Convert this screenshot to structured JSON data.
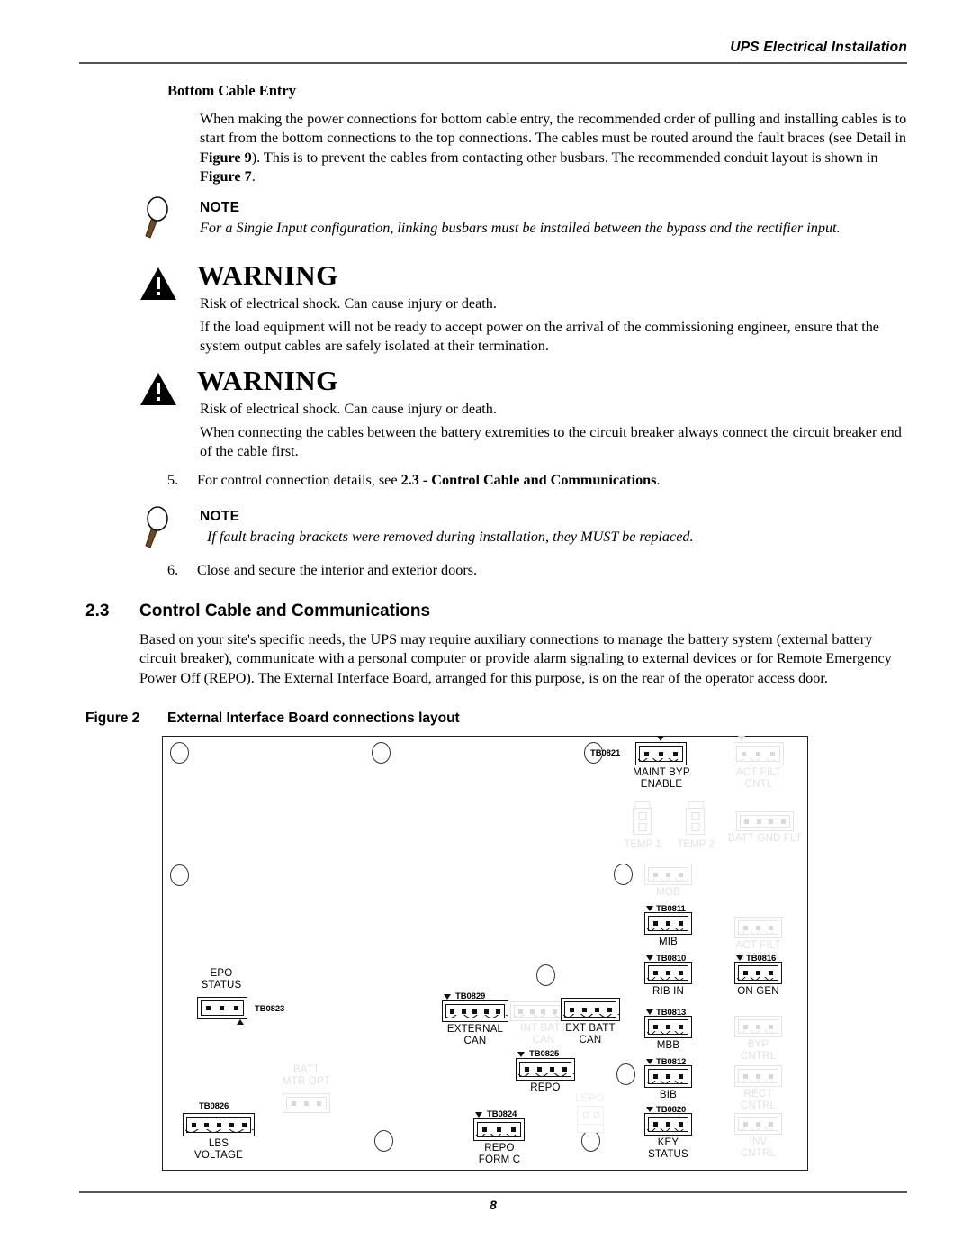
{
  "header": {
    "title": "UPS Electrical Installation"
  },
  "footer": {
    "page_number": "8"
  },
  "body": {
    "bottom_cable_entry_heading": "Bottom Cable Entry",
    "bottom_cable_entry_p1_a": "When making the power connections for bottom cable entry, the recommended order of pulling and installing cables is to start from the bottom connections to the top connections. The cables must be routed around the fault braces (see Detail in ",
    "bottom_cable_entry_p1_fig9": "Figure 9",
    "bottom_cable_entry_p1_b": "). This is to prevent the cables from contacting other busbars. The recommended conduit layout is shown in ",
    "bottom_cable_entry_p1_fig7": "Figure 7",
    "bottom_cable_entry_p1_c": ".",
    "note1_word": "NOTE",
    "note1_text": "For a Single Input configuration, linking busbars must be installed between the bypass and the rectifier input.",
    "warning1_word": "WARNING",
    "warning1_line1": "Risk of electrical shock. Can cause injury or death.",
    "warning1_line2": "If the load equipment will not be ready to accept power on the arrival of the commissioning engineer, ensure that the system output cables are safely isolated at their termination.",
    "warning2_word": "WARNING",
    "warning2_line1": "Risk of electrical shock. Can cause injury or death.",
    "warning2_line2": "When connecting the cables between the battery extremities to the circuit breaker always connect the circuit breaker end of the cable first.",
    "item5_num": "5.",
    "item5_a": "For control connection details, see ",
    "item5_b": "2.3 - Control Cable and Communications",
    "item5_c": ".",
    "note2_word": "NOTE",
    "note2_text": "If fault bracing brackets were removed during installation, they MUST be replaced.",
    "item6_num": "6.",
    "item6_text": "Close and secure the interior and exterior doors.",
    "section_number": "2.3",
    "section_title": "Control Cable and Communications",
    "section_para": "Based on your site's specific needs, the UPS may require auxiliary connections to manage the battery system (external battery circuit breaker), communicate with a personal computer or provide alarm signaling to external devices or for Remote Emergency Power Off (REPO). The External Interface Board, arranged for this purpose, is on the rear of the operator access door.",
    "figure_label": "Figure 2",
    "figure_title": "External Interface Board connections layout"
  },
  "figure": {
    "connectors": [
      {
        "id": "tb0821",
        "tb": "TB0821",
        "label": "MAINT BYP\nENABLE",
        "pins": 3,
        "ghost": false
      },
      {
        "id": "act_filt_cntl",
        "tb": "",
        "label": "ACT FILT\nCNTL",
        "pins": 3,
        "ghost": true
      },
      {
        "id": "temp1",
        "tb": "",
        "label": "TEMP 1",
        "pins": 2,
        "ghost": true
      },
      {
        "id": "temp2",
        "tb": "",
        "label": "TEMP 2",
        "pins": 2,
        "ghost": true
      },
      {
        "id": "batt_gnd_flt",
        "tb": "",
        "label": "BATT GND FLT",
        "pins": 4,
        "ghost": true
      },
      {
        "id": "mob",
        "tb": "",
        "label": "MOB",
        "pins": 3,
        "ghost": true
      },
      {
        "id": "tb0811",
        "tb": "TB0811",
        "label": "MIB",
        "pins": 3,
        "ghost": false
      },
      {
        "id": "act_filt_status",
        "tb": "",
        "label": "ACT FILT\nSTATUS",
        "pins": 3,
        "ghost": true
      },
      {
        "id": "tb0810",
        "tb": "TB0810",
        "label": "RIB IN",
        "pins": 3,
        "ghost": false
      },
      {
        "id": "tb0816",
        "tb": "TB0816",
        "label": "ON GEN",
        "pins": 3,
        "ghost": false
      },
      {
        "id": "tb0823",
        "tb": "TB0823",
        "label": "EPO\nSTATUS",
        "pins": 3,
        "ghost": false
      },
      {
        "id": "tb0829",
        "tb": "TB0829",
        "label": "EXTERNAL\nCAN",
        "pins": 5,
        "ghost": false
      },
      {
        "id": "int_batt_can",
        "tb": "",
        "label": "INT BATT\nCAN",
        "pins": 5,
        "ghost": true
      },
      {
        "id": "ext_batt_can",
        "tb": "",
        "label": "EXT BATT\nCAN",
        "pins": 4,
        "ghost": false
      },
      {
        "id": "tb0813",
        "tb": "TB0813",
        "label": "MBB",
        "pins": 3,
        "ghost": false
      },
      {
        "id": "byp_cntrl",
        "tb": "",
        "label": "BYP\nCNTRL",
        "pins": 3,
        "ghost": true
      },
      {
        "id": "tb0825",
        "tb": "TB0825",
        "label": "REPO",
        "pins": 4,
        "ghost": false
      },
      {
        "id": "tb0812",
        "tb": "TB0812",
        "label": "BIB",
        "pins": 3,
        "ghost": false
      },
      {
        "id": "rect_cntrl",
        "tb": "",
        "label": "RECT\nCNTRL",
        "pins": 3,
        "ghost": true
      },
      {
        "id": "batt_mtr_opt",
        "tb": "",
        "label": "BATT\nMTR OPT",
        "pins": 3,
        "ghost": true
      },
      {
        "id": "tb0826",
        "tb": "TB0826",
        "label": "LBS\nVOLTAGE",
        "pins": 5,
        "ghost": false
      },
      {
        "id": "tb0824",
        "tb": "TB0824",
        "label": "REPO\nFORM C",
        "pins": 3,
        "ghost": false
      },
      {
        "id": "tb0820",
        "tb": "TB0820",
        "label": "KEY\nSTATUS",
        "pins": 3,
        "ghost": false
      },
      {
        "id": "inv_cntrl",
        "tb": "",
        "label": "INV\nCNTRL",
        "pins": 3,
        "ghost": true
      },
      {
        "id": "lepo",
        "tb": "",
        "label": "LEPO",
        "pins": 2,
        "ghost": true
      }
    ]
  }
}
